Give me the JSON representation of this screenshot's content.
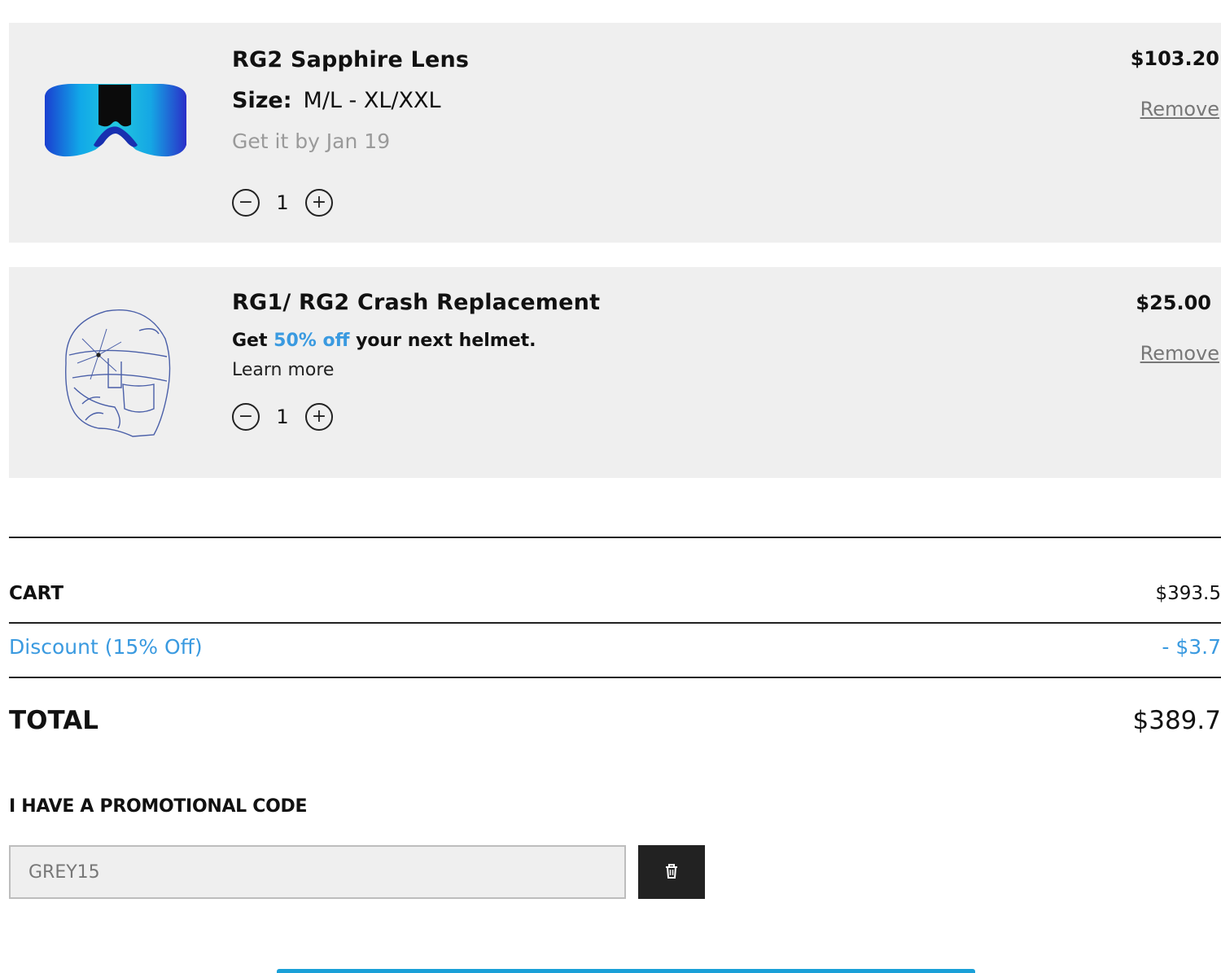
{
  "items": [
    {
      "name": "RG2 Sapphire Lens",
      "size_label": "Size:",
      "size_value": "M/L - XL/XXL",
      "eta": "Get it by Jan 19",
      "qty": "1",
      "price": "$103.20",
      "remove": "Remove",
      "minus": "−",
      "plus": "+"
    },
    {
      "name": "RG1/ RG2 Crash Replacement",
      "promo_pre": "Get ",
      "promo_hl": "50% off",
      "promo_post": " your next helmet.",
      "learn_more": "Learn more",
      "qty": "1",
      "price": "$25.00",
      "remove": "Remove",
      "minus": "−",
      "plus": "+"
    }
  ],
  "summary": {
    "cart_label": "CART",
    "cart_value": "$393.5",
    "discount_label": "Discount (15% Off)",
    "discount_value": "- $3.7",
    "total_label": "TOTAL",
    "total_value": "$389.7"
  },
  "promo_code": {
    "heading": "I HAVE A PROMOTIONAL CODE",
    "value": "GREY15"
  },
  "colors": {
    "accent": "#3a9ae0",
    "checkout_bar": "#1aa0d8"
  }
}
